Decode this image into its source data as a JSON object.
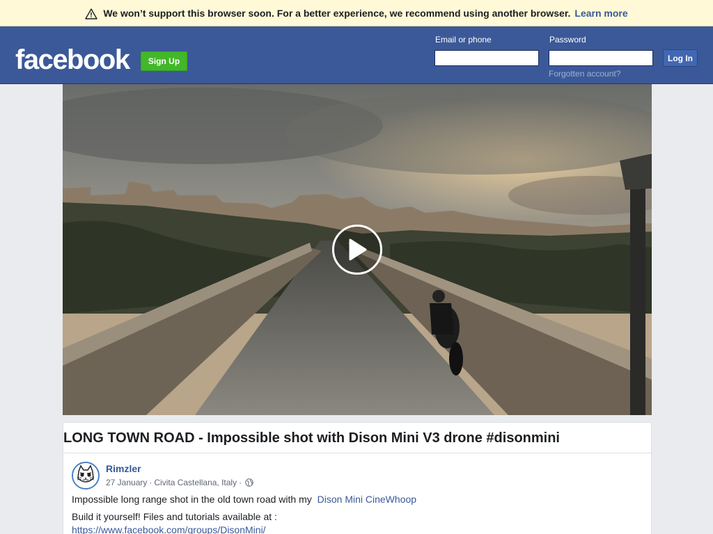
{
  "banner": {
    "message": "We won’t support this browser soon. For a better experience, we recommend using another browser.",
    "learn_more": "Learn more",
    "icon": "warning-icon"
  },
  "header": {
    "logo": "facebook",
    "signup_label": "Sign Up",
    "email_label": "Email or phone",
    "password_label": "Password",
    "email_value": "",
    "password_value": "",
    "login_label": "Log In",
    "forgot_label": "Forgotten account?"
  },
  "video": {
    "play_icon": "play-icon"
  },
  "post": {
    "title": "LONG TOWN ROAD - Impossible shot with Dison Mini V3 drone #disonmini",
    "author": "Rimzler",
    "date": "27 January",
    "separator": "·",
    "location": "Civita Castellana, Italy",
    "privacy_icon": "globe-icon",
    "text_1": "Impossible long range shot in the old town road with my",
    "text_1_link": "Dison Mini CineWhoop",
    "text_2": "Build it yourself! Files and tutorials available at :",
    "text_3_link": "https://www.facebook.com/groups/DisonMini/"
  },
  "colors": {
    "header_bg": "#3b5998",
    "banner_bg": "#fff9d7",
    "signup_green": "#42b72a",
    "link_blue": "#385898",
    "page_bg": "#e9ebee"
  }
}
